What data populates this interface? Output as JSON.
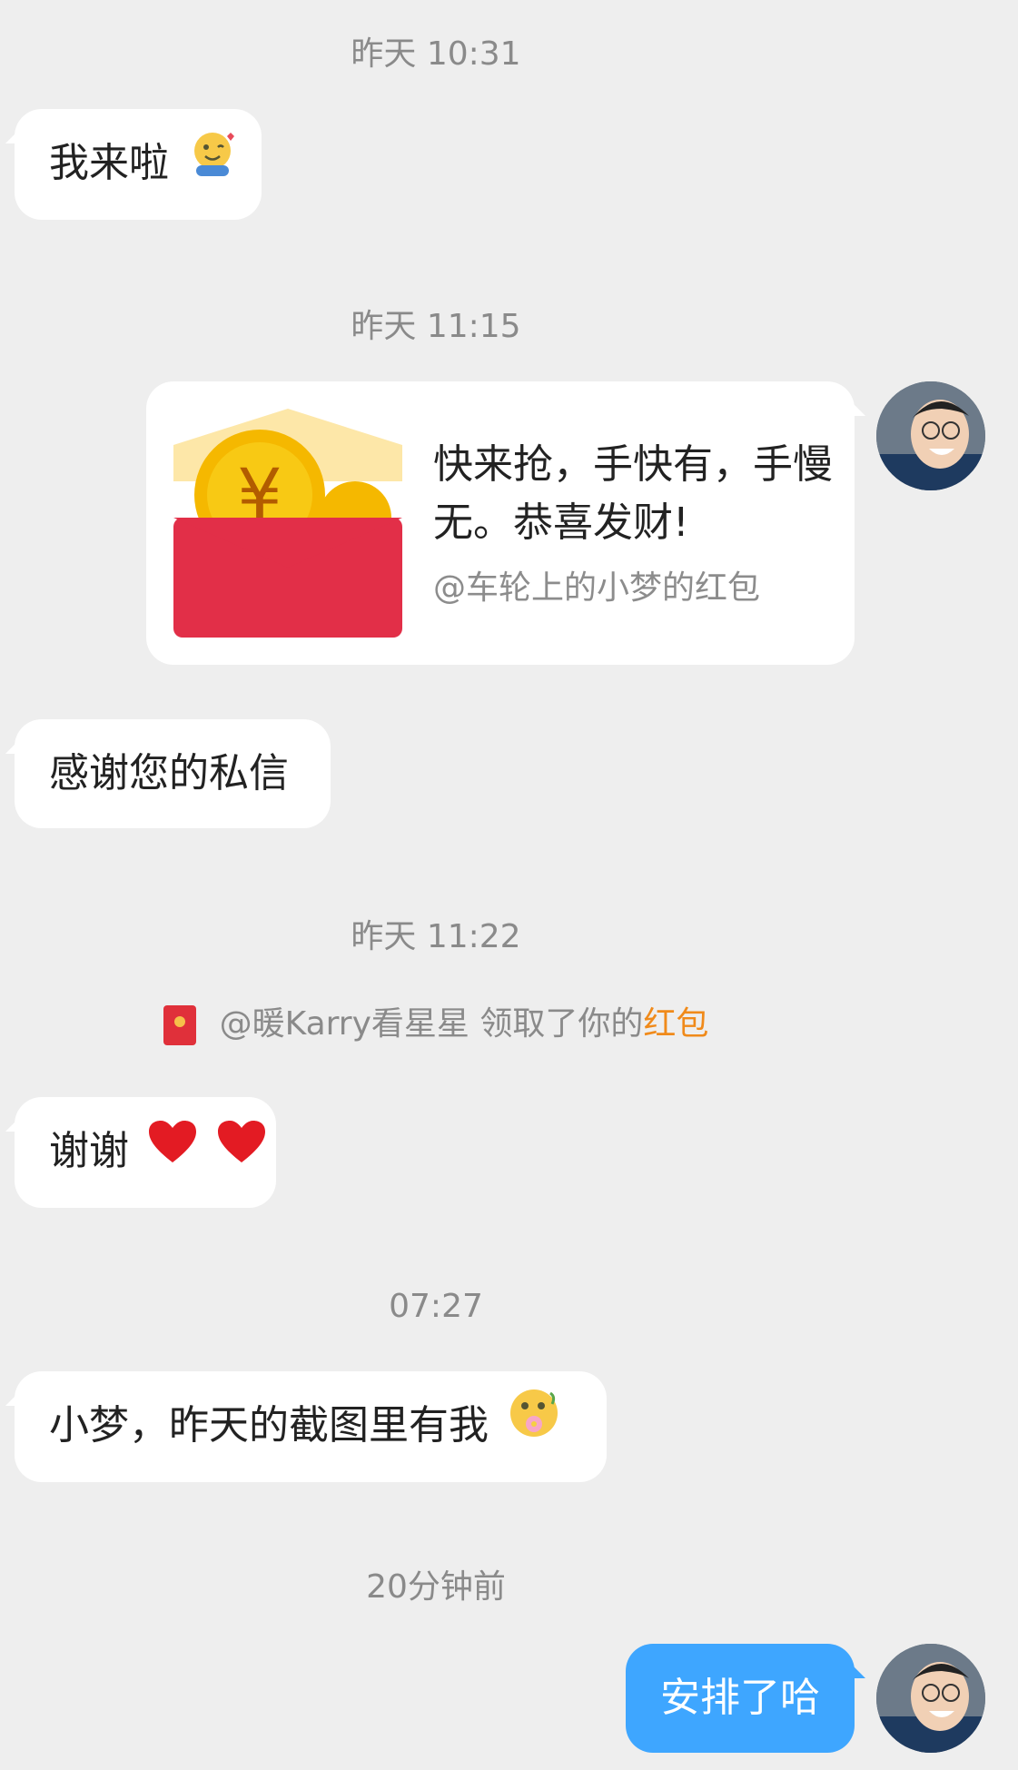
{
  "messages": {
    "ts1": "昨天 10:31",
    "msg1": "我来啦",
    "ts2": "昨天 11:15",
    "redpack_text": "快来抢，手快有，手慢无。恭喜发财!",
    "redpack_sender": "@车轮上的小梦的红包",
    "msg2": "感谢您的私信",
    "ts3": "昨天 11:22",
    "notice_user": "@暖Karry看星星",
    "notice_mid": "领取了你的",
    "notice_link": "红包",
    "msg3": "谢谢",
    "ts4": "07:27",
    "msg4": "小梦，昨天的截图里有我",
    "ts5": "20分钟前",
    "msg5": "安排了哈"
  },
  "icons": {
    "hug": "hug-emoji-icon",
    "heart": "red-heart-icon",
    "flower": "flower-face-emoji-icon",
    "redpacket": "red-packet-icon"
  },
  "colors": {
    "background": "#eeeeee",
    "bubble": "#ffffff",
    "sent_bubble": "#3ea6ff",
    "highlight": "#f08a1a",
    "timestamp": "#8a8a8a"
  }
}
